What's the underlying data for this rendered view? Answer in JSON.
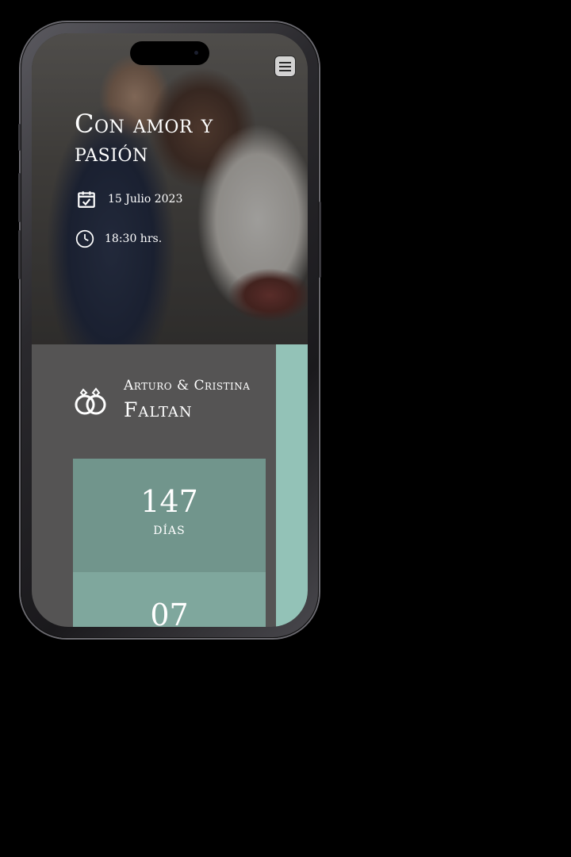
{
  "hero": {
    "title": "Con amor y pasión",
    "date": "15 Julio 2023",
    "time": "18:30 hrs."
  },
  "couple": {
    "names": "Arturo & Cristina",
    "countdown_label": "Faltan"
  },
  "countdown": [
    {
      "value": "147",
      "label": "días"
    },
    {
      "value": "07",
      "label": ""
    }
  ],
  "colors": {
    "teal": "#93c2b7",
    "dark_panel": "#555454",
    "counter_box": "#71958c"
  },
  "icons": [
    "menu-icon",
    "calendar-check-icon",
    "clock-icon",
    "wedding-rings-icon"
  ]
}
